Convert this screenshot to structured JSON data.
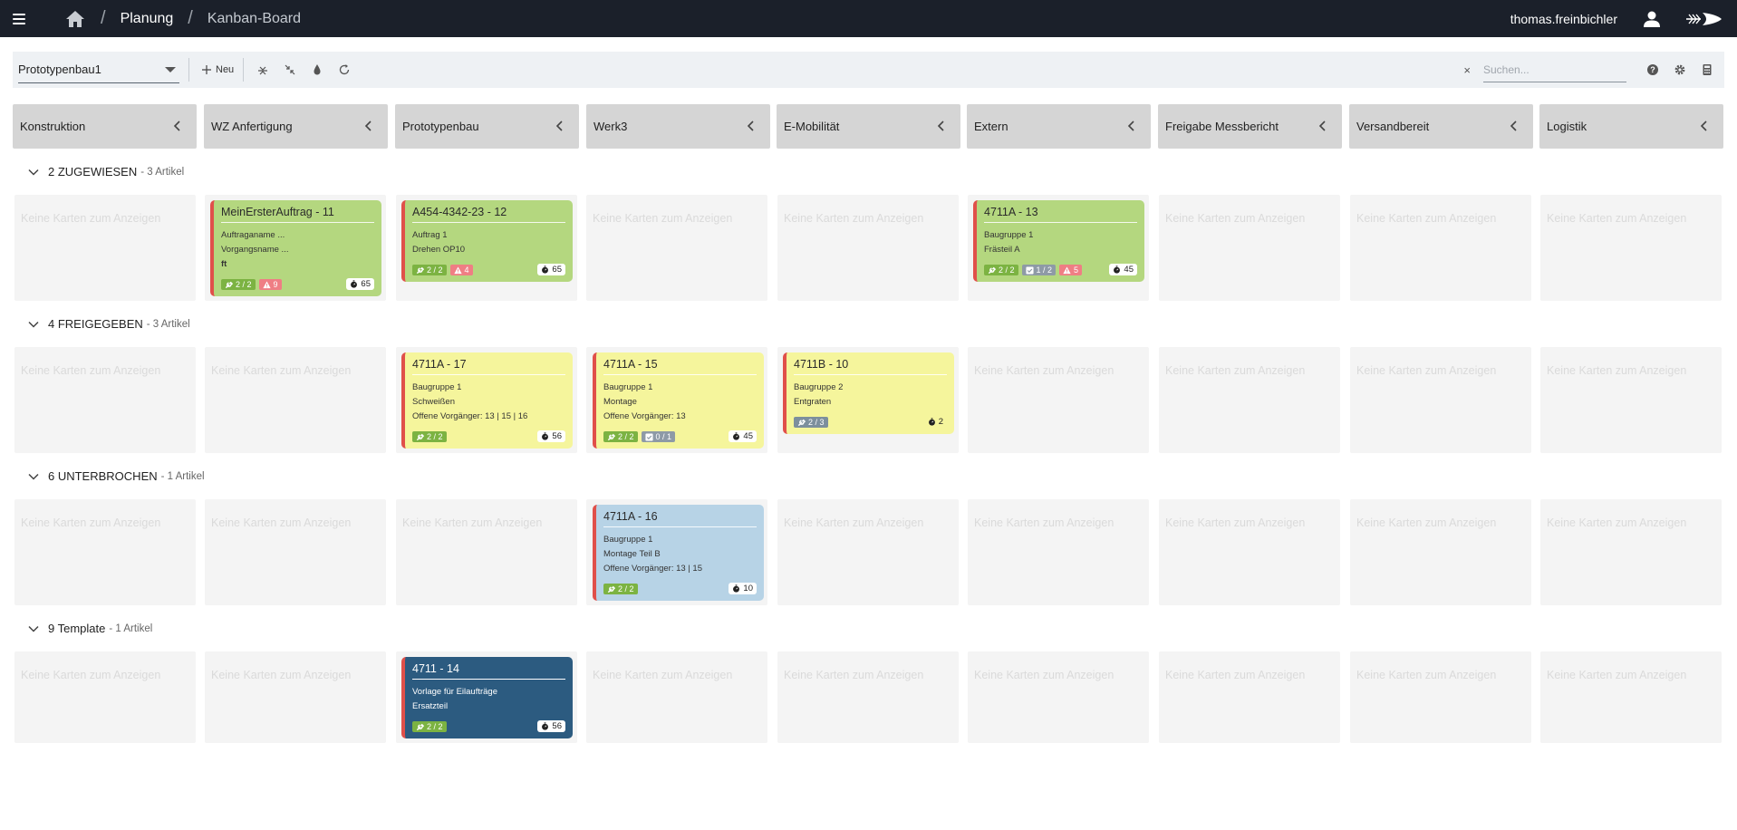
{
  "appbar": {
    "breadcrumb": [
      "Planung",
      "Kanban-Board"
    ],
    "user": "thomas.freinbichler"
  },
  "toolbar": {
    "board": "Prototypenbau1",
    "new_label": "Neu",
    "search_placeholder": "Suchen...",
    "clear_label": "×"
  },
  "columns": [
    {
      "label": "Konstruktion"
    },
    {
      "label": "WZ Anfertigung"
    },
    {
      "label": "Prototypenbau"
    },
    {
      "label": "Werk3"
    },
    {
      "label": "E-Mobilität"
    },
    {
      "label": "Extern"
    },
    {
      "label": "Freigabe Messbericht"
    },
    {
      "label": "Versandbereit"
    },
    {
      "label": "Logistik"
    }
  ],
  "empty_text": "Keine Karten zum Anzeigen",
  "groups": [
    {
      "name": "2 ZUGEWIESEN",
      "count": "- 3 Artikel"
    },
    {
      "name": "4 FREIGEGEBEN",
      "count": "- 3 Artikel"
    },
    {
      "name": "6 UNTERBROCHEN",
      "count": "- 1 Artikel"
    },
    {
      "name": "9 Template",
      "count": "- 1 Artikel"
    }
  ],
  "cards": [
    {
      "title": "MeinErsterAuftrag - 11",
      "lines": [
        "Auftraganame ...",
        "Vorgangsname ...",
        "ft"
      ],
      "badges": [
        {
          "type": "tool",
          "text": "2 / 2"
        },
        {
          "type": "warn",
          "text": "9"
        }
      ],
      "timer": "65"
    },
    {
      "title": "A454-4342-23 - 12",
      "lines": [
        "Auftrag 1",
        "Drehen OP10"
      ],
      "badges": [
        {
          "type": "tool",
          "text": "2 / 2"
        },
        {
          "type": "warn",
          "text": "4"
        }
      ],
      "timer": "65"
    },
    {
      "title": "4711A - 13",
      "lines": [
        "Baugruppe 1",
        "Frästeil A"
      ],
      "badges": [
        {
          "type": "tool",
          "text": "2 / 2"
        },
        {
          "type": "check",
          "text": "1 / 2"
        },
        {
          "type": "warn",
          "text": "5"
        }
      ],
      "timer": "45"
    },
    {
      "title": "4711A - 17",
      "lines": [
        "Baugruppe 1",
        "Schweißen",
        "Offene Vorgänger: 13 | 15 | 16"
      ],
      "badges": [
        {
          "type": "tool",
          "text": "2 / 2"
        }
      ],
      "timer": "56"
    },
    {
      "title": "4711A - 15",
      "lines": [
        "Baugruppe 1",
        "Montage",
        "Offene Vorgänger: 13"
      ],
      "badges": [
        {
          "type": "tool",
          "text": "2 / 2"
        },
        {
          "type": "check",
          "text": "0 / 1"
        }
      ],
      "timer": "45"
    },
    {
      "title": "4711B - 10",
      "lines": [
        "Baugruppe 2",
        "Entgraten"
      ],
      "badges": [
        {
          "type": "tool-gray",
          "text": "2 / 3"
        }
      ],
      "timer": "2"
    },
    {
      "title": "4711A - 16",
      "lines": [
        "Baugruppe 1",
        "Montage Teil B",
        "Offene Vorgänger: 13 | 15"
      ],
      "badges": [
        {
          "type": "tool",
          "text": "2 / 2"
        }
      ],
      "timer": "10"
    },
    {
      "title": "4711 - 14",
      "lines": [
        "Vorlage für Eilaufträge",
        "Ersatzteil"
      ],
      "badges": [
        {
          "type": "tool",
          "text": "2 / 2"
        }
      ],
      "timer": "56"
    }
  ],
  "colors": {
    "appbar": "#1b202a",
    "card_green": "#b4d77f",
    "card_yellow": "#f5f59c",
    "card_blue": "#b7d3e6",
    "card_navy": "#2c5b80",
    "card_border": "#e0504a"
  }
}
